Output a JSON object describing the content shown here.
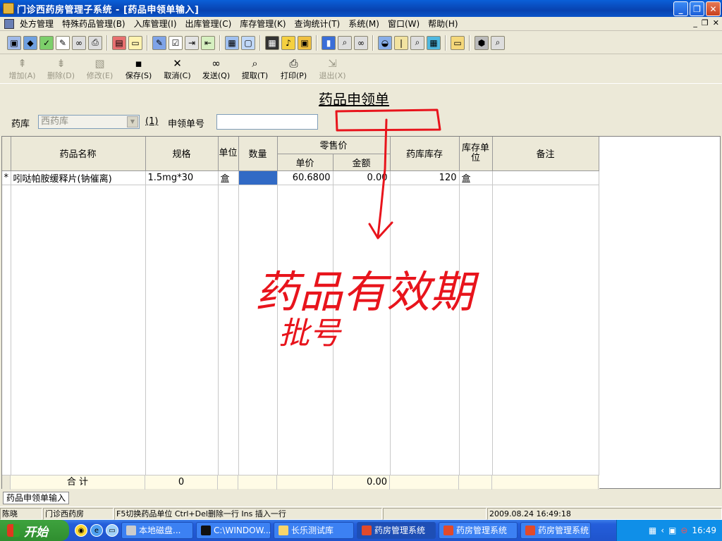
{
  "window": {
    "title": "门诊西药房管理子系统 - [药品申领单输入]"
  },
  "menu": [
    "处方管理",
    "特殊药品管理(B)",
    "入库管理(I)",
    "出库管理(C)",
    "库存管理(K)",
    "查询统计(T)",
    "系统(M)",
    "窗口(W)",
    "帮助(H)"
  ],
  "toolbar2": {
    "add": "增加(A)",
    "delete": "删除(D)",
    "modify": "修改(E)",
    "save": "保存(S)",
    "cancel": "取消(C)",
    "send": "发送(Q)",
    "fetch": "提取(T)",
    "print": "打印(P)",
    "exit": "退出(X)"
  },
  "form": {
    "title": "药品申领单",
    "warehouse_label": "药库",
    "warehouse_value": "西药库",
    "index_label": "(1)",
    "request_no_label": "申领单号",
    "request_no_value": ""
  },
  "grid": {
    "headers": {
      "name": "药品名称",
      "spec": "规格",
      "unit": "单位",
      "qty": "数量",
      "retail": "零售价",
      "unit_price": "单价",
      "amount": "金额",
      "stock": "药库库存",
      "stock_unit": "库存单位",
      "remark": "备注"
    },
    "rows": [
      {
        "marker": "*",
        "name": "吲哒帕胺缓释片(钠催离)",
        "spec": "1.5mg*30",
        "unit": "盒",
        "qty": "",
        "unit_price": "60.6800",
        "amount": "0.00",
        "stock": "120",
        "stock_unit": "盒",
        "remark": ""
      }
    ],
    "total": {
      "label": "合  计",
      "spec_total": "0",
      "amount_total": "0.00"
    }
  },
  "tabs": [
    "药品申领单输入"
  ],
  "status": {
    "user": "陈晓",
    "dept": "门诊西药房",
    "hint": "F5切换药品单位 Ctrl+Del删除一行 Ins 插入一行",
    "datetime": "2009.08.24 16:49:18"
  },
  "annotation": {
    "line1": "药品有效期",
    "line2": "批号",
    "color": "#e8141c"
  },
  "taskbar": {
    "start": "开始",
    "tasks": [
      "本地磁盘...",
      "C:\\WINDOW...",
      "长乐测试库",
      "药房管理系统",
      "药房管理系统",
      "药房管理系统"
    ],
    "clock": "16:49"
  }
}
